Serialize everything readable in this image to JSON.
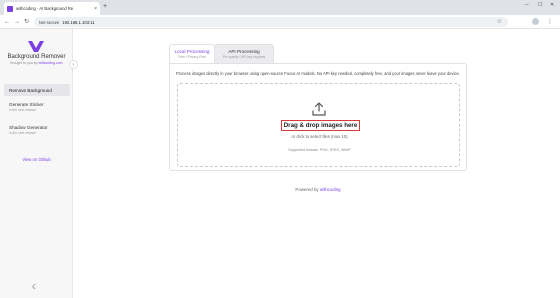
{
  "browser": {
    "tab_title": "withcoding - AI Background Re",
    "url_warning": "Not secure",
    "url": "192.168.1.103:11",
    "icons": [
      "back-icon",
      "forward-icon",
      "reload-icon",
      "star-icon",
      "close-icon",
      "plus-icon"
    ]
  },
  "sidebar": {
    "brand": "Background Remover",
    "brand_sub_prefix": "brought to you by ",
    "brand_sub_link": "withcoding.com",
    "items": [
      {
        "label": "Remove Background"
      },
      {
        "label": "Generate Sticker",
        "note": "in the next release"
      },
      {
        "label": "Shadow Generator",
        "note": "in the next release"
      }
    ],
    "github": "View on Github"
  },
  "main": {
    "tabs": [
      {
        "title": "Local Processing",
        "sub": "Free / Privacy First"
      },
      {
        "title": "API Processing",
        "sub": "Pro quality / API key required"
      }
    ],
    "description": "Process images directly in your browser using open-source Focus AI models. No API key needed, completely free, and your images never leave your device.",
    "drop_title": "Drag & drop images here",
    "drop_sub": "or click to select files (max 10)",
    "formats": "Supported formats: PNG, JPEG, WebP",
    "powered_prefix": "Powered by ",
    "powered_link": "withcoding"
  },
  "colors": {
    "accent": "#7b3fe4",
    "highlight": "#d93a3a"
  }
}
